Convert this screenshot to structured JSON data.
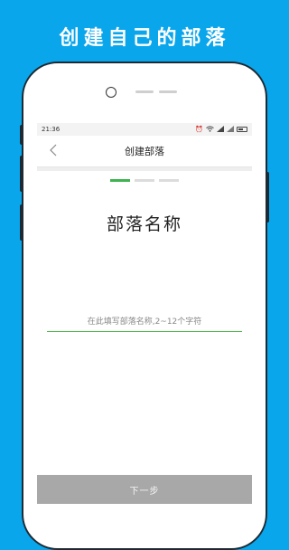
{
  "promo": {
    "title": "创建自己的部落"
  },
  "status_bar": {
    "time": "21:36"
  },
  "header": {
    "title": "创建部落"
  },
  "steps": {
    "total": 3,
    "current": 1
  },
  "main": {
    "heading": "部落名称",
    "name_input": {
      "value": "",
      "placeholder": "在此填写部落名称,2~12个字符"
    }
  },
  "footer": {
    "next_label": "下一步"
  },
  "colors": {
    "background": "#0aa6ec",
    "accent": "#3fb34f",
    "button_disabled": "#a8a8a8"
  },
  "icons": {
    "back": "chevron-left-icon",
    "alarm": "alarm-icon",
    "wifi": "wifi-icon",
    "signal": "signal-icon",
    "battery": "battery-icon"
  }
}
